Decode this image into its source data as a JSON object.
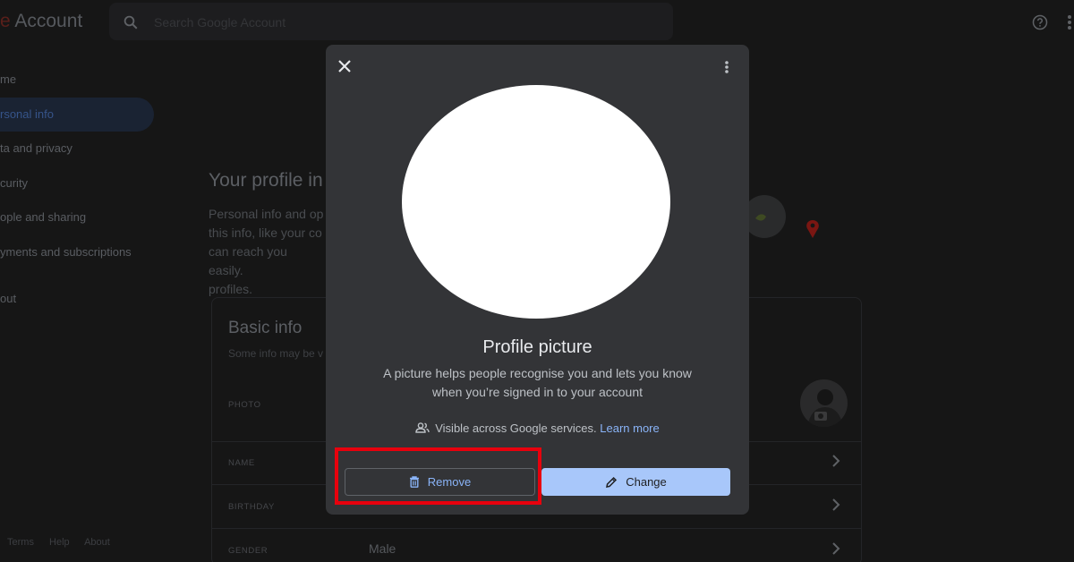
{
  "header": {
    "brand_colored": "e",
    "brand_text": " Account",
    "search_placeholder": "Search Google Account",
    "help_icon": "help-circle-icon",
    "apps_icon": "apps-icon"
  },
  "sidebar": {
    "items": [
      {
        "label": "me",
        "active": false
      },
      {
        "label": "rsonal info",
        "active": true
      },
      {
        "label": "ta and privacy",
        "active": false
      },
      {
        "label": "curity",
        "active": false
      },
      {
        "label": "ople and sharing",
        "active": false
      },
      {
        "label": "yments and subscriptions",
        "active": false
      },
      {
        "label": "out",
        "active": false
      }
    ],
    "footer": [
      "Terms",
      "Help",
      "About"
    ]
  },
  "main": {
    "title": "Your profile in",
    "description": "Personal info and op\nthis info, like your co\ncan reach you easily.\nprofiles.",
    "card_title": "Basic info",
    "card_subtitle": "Some info may be v",
    "rows": [
      {
        "label": "PHOTO",
        "value": ""
      },
      {
        "label": "NAME",
        "value": ""
      },
      {
        "label": "BIRTHDAY",
        "value": ""
      },
      {
        "label": "GENDER",
        "value": "Male"
      }
    ]
  },
  "dialog": {
    "close_icon": "close-icon",
    "more_icon": "more-vert-icon",
    "title": "Profile picture",
    "description": "A picture helps people recognise you and lets you know when you’re signed in to your account",
    "visibility_text": "Visible across Google services.",
    "learn_more": "Learn more",
    "remove_label": "Remove",
    "change_label": "Change"
  },
  "colors": {
    "dialog_bg": "#333437",
    "accent_blue": "#8ab4f8",
    "primary_button": "#a8c7fa",
    "highlight_red": "#e8000d"
  }
}
